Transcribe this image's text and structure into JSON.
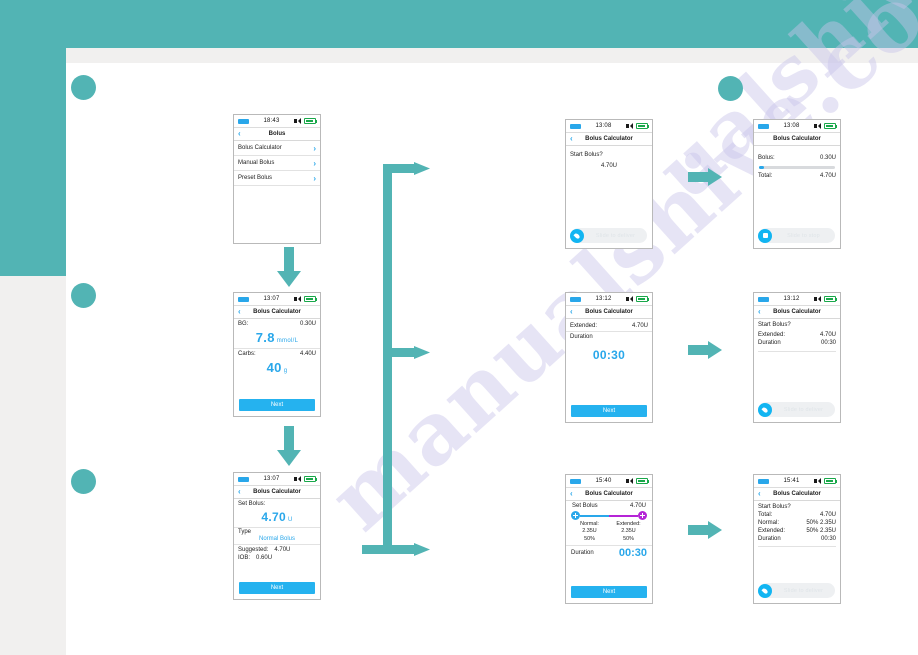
{
  "theme": {
    "teal": "#52b4b4",
    "blue": "#29a7ea",
    "bright_blue": "#25b2ef",
    "purple": "#b524d6",
    "battery_green": "#19a84a",
    "panel_bg": "#ffffff",
    "page_bg": "#f1f0ef"
  },
  "watermark": {
    "line1": "manualshive.com",
    "line2": "ualshive.com"
  },
  "icons": {
    "back_chevron": "‹",
    "row_chevron": "›"
  },
  "flow": {
    "step_arrow_label": "next-step-arrow",
    "branch_arrow_label": "branch-arrow"
  },
  "screens": {
    "bolus_menu": {
      "status": {
        "time": "18:43"
      },
      "title": "Bolus",
      "items": [
        {
          "label": "Bolus Calculator"
        },
        {
          "label": "Manual Bolus"
        },
        {
          "label": "Preset Bolus"
        }
      ]
    },
    "calc_bg_carbs": {
      "status": {
        "time": "13:07"
      },
      "title": "Bolus Calculator",
      "bg_label": "BG:",
      "bg_value": "0.30U",
      "bg_big": "7.8",
      "bg_unit": "mmol/L",
      "carbs_label": "Carbs:",
      "carbs_value": "4.40U",
      "carbs_big": "40",
      "carbs_unit": "g",
      "next_label": "Next"
    },
    "calc_set_bolus": {
      "status": {
        "time": "13:07"
      },
      "title": "Bolus Calculator",
      "set_label": "Set Bolus:",
      "set_big": "4.70",
      "set_unit": "U",
      "type_label": "Type",
      "type_value": "Normal Bolus",
      "suggested_label": "Suggested:",
      "suggested_value": "4.70U",
      "iob_label": "IOB:",
      "iob_value": "0.60U",
      "next_label": "Next"
    },
    "confirm_normal": {
      "status": {
        "time": "13:08"
      },
      "title": "Bolus Calculator",
      "question": "Start Bolus?",
      "amount": "4.70U",
      "action_label": "Slide to deliver"
    },
    "delivering": {
      "status": {
        "time": "13:08"
      },
      "title": "Bolus Calculator",
      "bolus_label": "Bolus:",
      "bolus_value": "0.30U",
      "progress_percent": 6,
      "total_label": "Total:",
      "total_value": "4.70U",
      "action_label": "Slide to stop"
    },
    "extended_duration": {
      "status": {
        "time": "13:12"
      },
      "title": "Bolus Calculator",
      "extended_label": "Extended:",
      "extended_value": "4.70U",
      "duration_label": "Duration",
      "duration_big": "00:30",
      "next_label": "Next"
    },
    "confirm_extended": {
      "status": {
        "time": "13:12"
      },
      "title": "Bolus Calculator",
      "question": "Start Bolus?",
      "rows": [
        {
          "k": "Extended:",
          "v": "4.70U"
        },
        {
          "k": "Duration",
          "v": "00:30"
        }
      ],
      "action_label": "Slide to deliver"
    },
    "split_bolus": {
      "status": {
        "time": "15:40"
      },
      "title": "Bolus Calculator",
      "set_label": "Set Bolus",
      "set_value": "4.70U",
      "normal_label": "Normal:",
      "normal_units": "2.35U",
      "normal_percent": "50%",
      "extended_label": "Extended:",
      "extended_units": "2.35U",
      "extended_percent": "50%",
      "duration_label": "Duration",
      "duration_value": "00:30",
      "next_label": "Next"
    },
    "confirm_split": {
      "status": {
        "time": "15:41"
      },
      "title": "Bolus Calculator",
      "question": "Start Bolus?",
      "rows": [
        {
          "k": "Total:",
          "v": "4.70U"
        },
        {
          "k": "Normal:",
          "v": "50%  2.35U"
        },
        {
          "k": "Extended:",
          "v": "50%  2.35U"
        },
        {
          "k": "Duration",
          "v": "00:30"
        }
      ],
      "action_label": "Slide to deliver"
    }
  }
}
